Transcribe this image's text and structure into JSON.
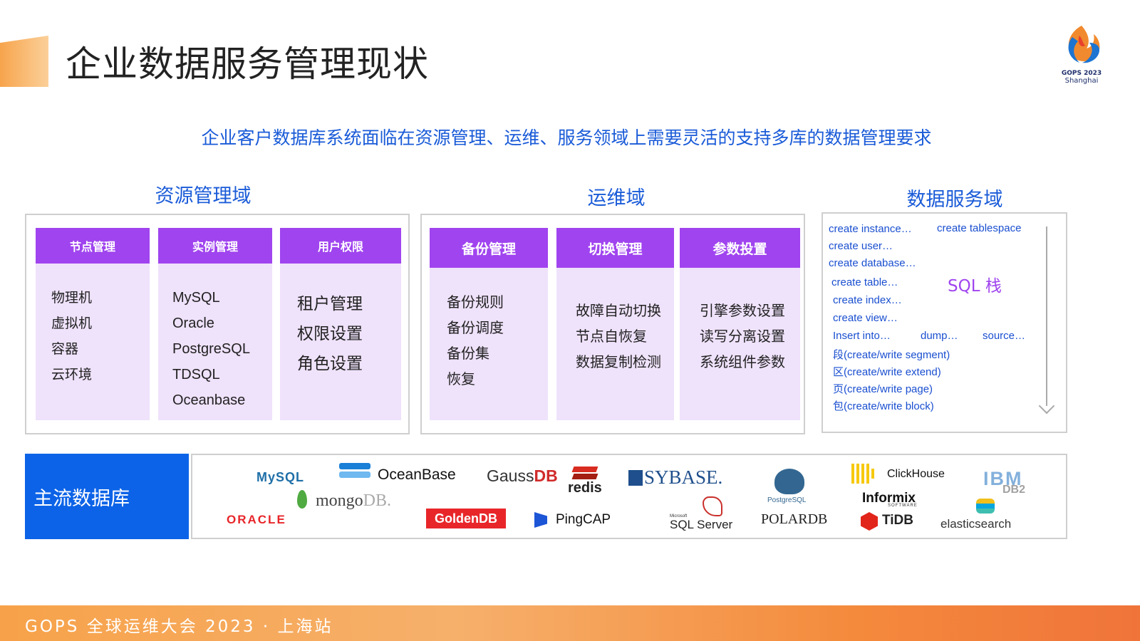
{
  "title": "企业数据服务管理现状",
  "logo": {
    "year_text": "GOPS 2023",
    "city_text": "Shanghai"
  },
  "subtitle": "企业客户数据库系统面临在资源管理、运维、服务领域上需要灵活的支持多库的数据管理要求",
  "resource_domain": {
    "title": "资源管理域",
    "columns": [
      {
        "header": "节点管理",
        "items": [
          "物理机",
          "虚拟机",
          "容器",
          "云环境"
        ]
      },
      {
        "header": "实例管理",
        "items": [
          "MySQL",
          "Oracle",
          "PostgreSQL",
          "TDSQL",
          "Oceanbase"
        ]
      },
      {
        "header": "用户权限",
        "items": [
          "租户管理",
          "权限设置",
          "角色设置"
        ]
      }
    ]
  },
  "ops_domain": {
    "title": "运维域",
    "columns": [
      {
        "header": "备份管理",
        "items": [
          "备份规则",
          "备份调度",
          "备份集",
          "恢复"
        ]
      },
      {
        "header": "切换管理",
        "items": [
          "故障自动切换",
          "节点自恢复",
          "数据复制检测"
        ]
      },
      {
        "header": "参数投置",
        "items": [
          "引擎参数设置",
          "读写分离设置",
          "系统组件参数"
        ]
      }
    ]
  },
  "data_service_domain": {
    "title": "数据服务域",
    "stack_label": "SQL 栈",
    "lines": [
      "create instance…",
      "create tablespace",
      "create user…",
      "create database…",
      "create table…",
      "create index…",
      "create view…",
      "Insert  into…",
      "dump…",
      "source…",
      "段(create/write segment)",
      "区(create/write extend)",
      "页(create/write page)",
      "包(create/write block)"
    ]
  },
  "mainstream_db": {
    "label": "主流数据库",
    "logos": {
      "mysql": "MySQL",
      "oceanbase": "OceanBase",
      "gaussdb_prefix": "Gauss",
      "gaussdb_suffix": "DB",
      "redis": "redis",
      "sybase": "SYBASE.",
      "postgresql": "PostgreSQL",
      "clickhouse": "ClickHouse",
      "ibm": "IBM",
      "db2": "DB2",
      "mongodb_prefix": "mongo",
      "mongodb_suffix": "DB.",
      "oracle": "ORACLE",
      "goldendb": "GoldenDB",
      "pingcap": "PingCAP",
      "sqlserver_top": "Microsoft",
      "sqlserver": "SQL Server",
      "polardb": "POLARDB",
      "informix": "Informix",
      "informix_sub": "SOFTWARE",
      "tidb": "TiDB",
      "elasticsearch": "elasticsearch"
    },
    "colors": {
      "oracle": "#e8262a",
      "goldendb": "#e8262a",
      "redis": "#d82c20",
      "mysql": "#1f6fa8",
      "oceanbase": "#1a7fd6",
      "tidb": "#e1251b",
      "sybase": "#1f4f8c",
      "ibm": "#1f70c1"
    }
  },
  "footer": {
    "text": "GOPS 全球运维大会 2023 · 上海站"
  }
}
